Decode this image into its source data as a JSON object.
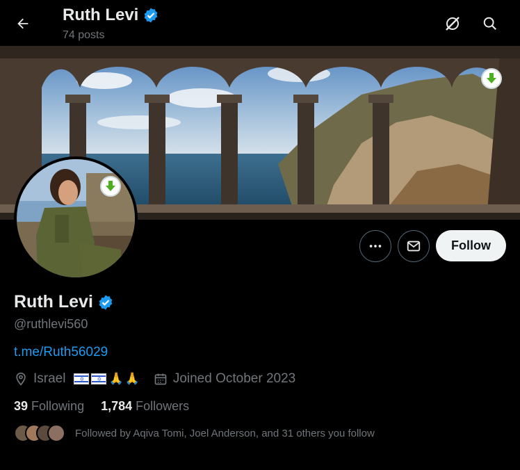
{
  "header": {
    "name": "Ruth Levi",
    "posts": "74 posts"
  },
  "profile": {
    "display_name": "Ruth Levi",
    "handle": "@ruthlevi560",
    "link": "t.me/Ruth56029",
    "location": "Israel",
    "joined": "Joined October 2023",
    "following_count": "39",
    "following_label": "Following",
    "followers_count": "1,784",
    "followers_label": "Followers",
    "followed_by": "Followed by Aqiva Tomi, Joel Anderson, and 31 others you follow"
  },
  "actions": {
    "follow_label": "Follow"
  },
  "icons": {
    "back": "arrow-left-icon",
    "grok": "grok-icon",
    "search": "search-icon",
    "more": "more-icon",
    "message": "mail-icon",
    "location": "location-pin-icon",
    "calendar": "calendar-icon",
    "verified": "verified-badge-icon",
    "download": "download-icon"
  },
  "colors": {
    "accent": "#1d9bf0",
    "background": "#000000",
    "text_primary": "#e7e9ea",
    "text_secondary": "#71767b",
    "follow_bg": "#eff3f4"
  }
}
